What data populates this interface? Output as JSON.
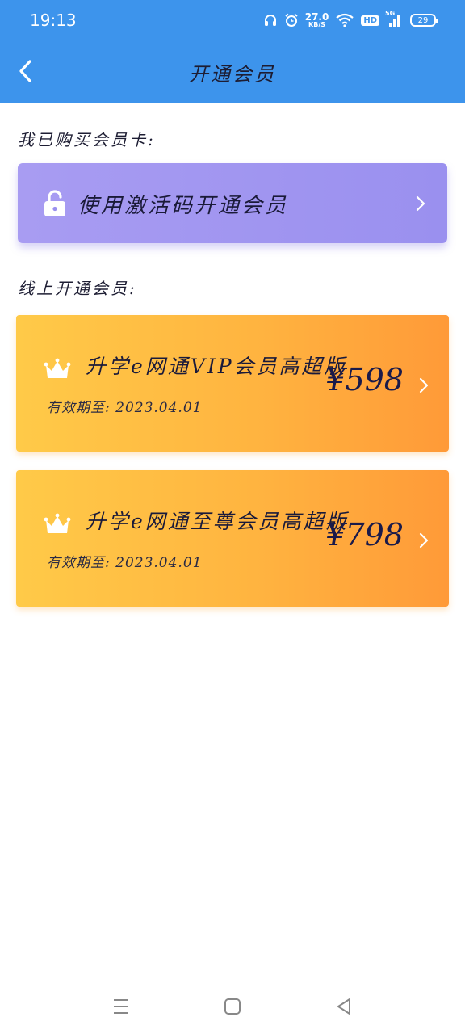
{
  "status_bar": {
    "time": "19:13",
    "speed_value": "27.0",
    "speed_unit": "KB/S",
    "hd": "HD",
    "network": "5G",
    "battery": "29"
  },
  "header": {
    "title": "开通会员",
    "bg_color": "#3d94ec"
  },
  "purchased_section": {
    "label": "我已购买会员卡:",
    "activate_button": {
      "label": "使用激活码开通会员",
      "icon": "lock-icon"
    }
  },
  "online_section": {
    "label": "线上开通会员:",
    "plans": [
      {
        "name": "升学e网通VIP会员高超版",
        "expiry": "有效期至: 2023.04.01",
        "price": "¥598",
        "icon": "crown-icon"
      },
      {
        "name": "升学e网通至尊会员高超版",
        "expiry": "有效期至: 2023.04.01",
        "price": "¥798",
        "icon": "crown-icon"
      }
    ]
  },
  "nav_bar": {
    "icons": [
      "menu-icon",
      "home-icon",
      "back-triangle-icon"
    ]
  }
}
